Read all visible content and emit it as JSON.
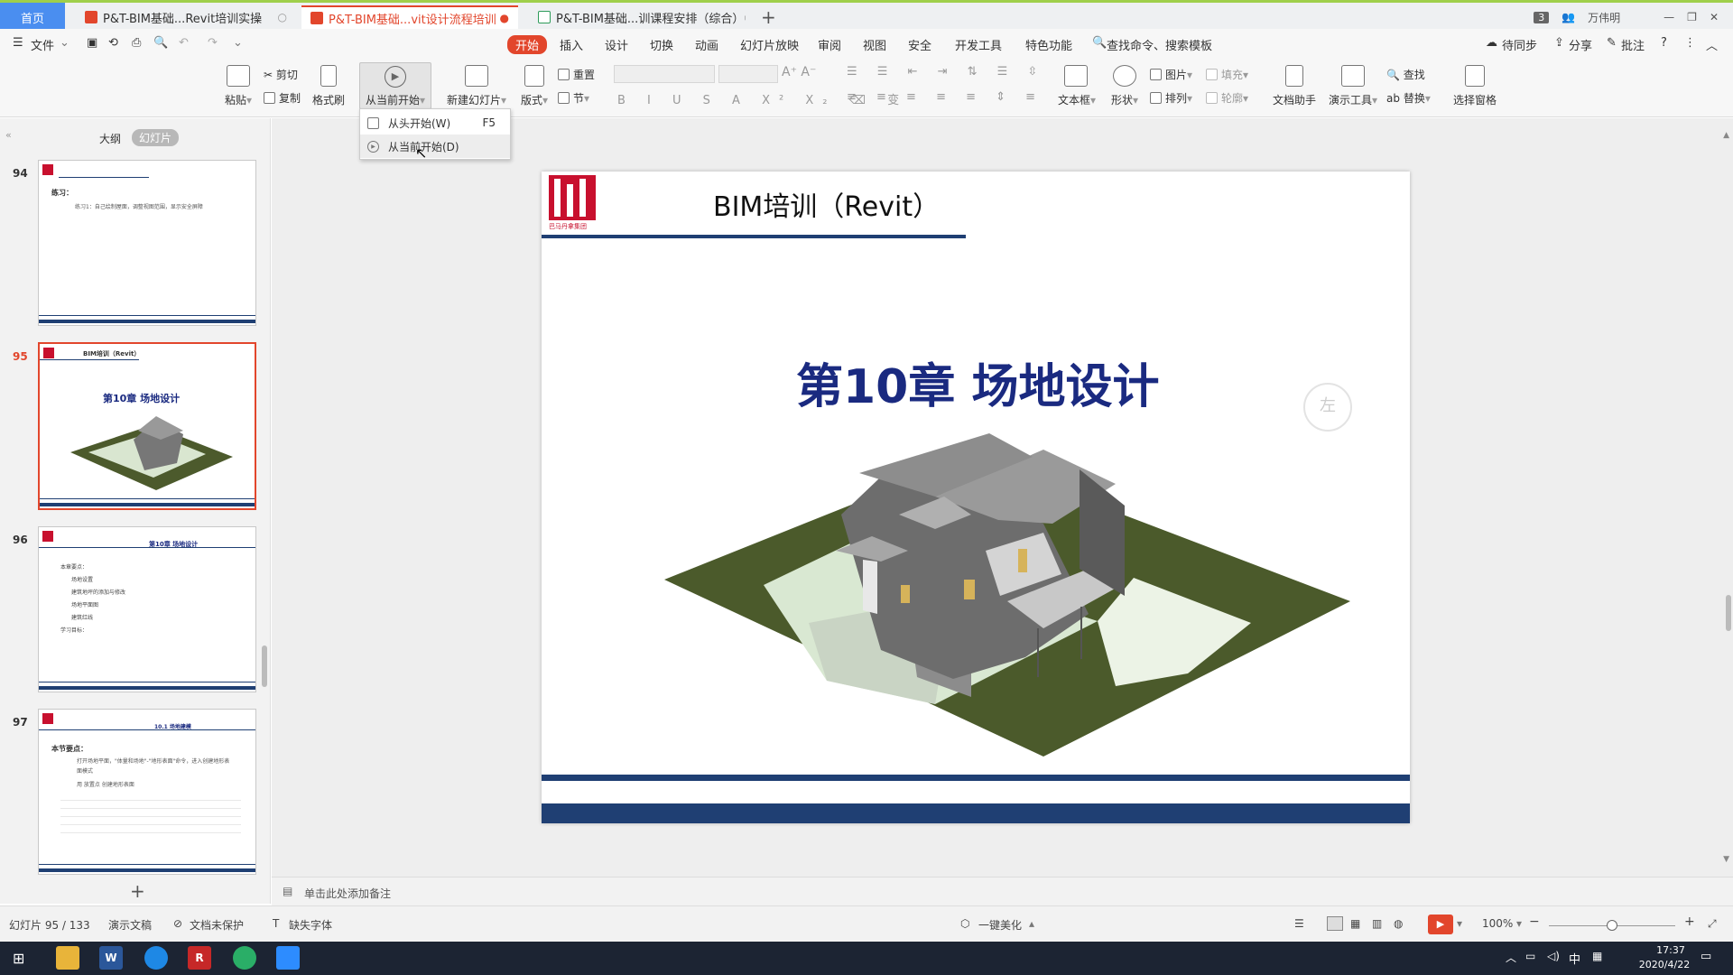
{
  "tabs": {
    "home": "首页",
    "tab1": "P&T-BIM基础...Revit培训实操",
    "tab2": "P&T-BIM基础...vit设计流程培训",
    "tab3": "P&T-BIM基础...训课程安排（综合）",
    "window_count": "3",
    "user": "万伟明"
  },
  "menu": {
    "file": "文件",
    "items": [
      "开始",
      "插入",
      "设计",
      "切换",
      "动画",
      "幻灯片放映",
      "审阅",
      "视图",
      "安全",
      "开发工具",
      "特色功能"
    ],
    "search": "查找命令、搜索模板",
    "sync": "待同步",
    "share": "分享",
    "comment": "批注"
  },
  "toolbar": {
    "paste": "粘贴",
    "cut": "剪切",
    "copy": "复制",
    "format_painter": "格式刷",
    "play_from_current": "从当前开始",
    "new_slide": "新建幻灯片",
    "layout": "版式",
    "reset": "重置",
    "section": "节",
    "textbox": "文本框",
    "shape": "形状",
    "picture": "图片",
    "arrange": "排列",
    "fill": "填充",
    "outline": "轮廓",
    "doc_assistant": "文档助手",
    "presentation_tools": "演示工具",
    "find": "查找",
    "replace": "替换",
    "select_pane": "选择窗格"
  },
  "dropdown": {
    "from_start": "从头开始(W)",
    "from_start_key": "F5",
    "from_current": "从当前开始(D)"
  },
  "left_panel": {
    "outline": "大纲",
    "slides": "幻灯片",
    "thumbs": [
      {
        "num": "94",
        "lines": [
          "练习：",
          "练习1：自己绘制屋面，调整视图范围，显示安全屏障"
        ]
      },
      {
        "num": "95",
        "title": "BIM培训（Revit）",
        "chapter": "第10章 场地设计"
      },
      {
        "num": "96",
        "title": "第10章 场地设计",
        "lines": [
          "本章要点：",
          "场地设置",
          "建筑地坪的添加与修改",
          "场地平面图",
          "建筑红线",
          "学习目标："
        ]
      },
      {
        "num": "97",
        "title": "10.1 场地建模",
        "lines": [
          "本节要点：",
          "打开场地平面，\"体量和场地\"-\"地形表面\"命令，进入创建地形表面模式",
          "用 放置点 创建地形表面"
        ]
      }
    ]
  },
  "slide": {
    "logo_caption": "巴马丹拿集团",
    "header": "BIM培训（Revit）",
    "chapter": "第10章  场地设计",
    "side_text": "左"
  },
  "notes": {
    "placeholder": "单击此处添加备注"
  },
  "status": {
    "slide_counter": "幻灯片 95 / 133",
    "theme": "演示文稿",
    "protect": "文档未保护",
    "missing_font": "缺失字体",
    "beautify": "一键美化",
    "zoom": "100%"
  },
  "taskbar": {
    "ime": "中",
    "time": "17:37",
    "date": "2020/4/22"
  },
  "colors": {
    "accent": "#e2462c",
    "navy": "#1f3f73",
    "chapter_blue": "#1a2a80",
    "lime_border": "#9fcf4b"
  }
}
